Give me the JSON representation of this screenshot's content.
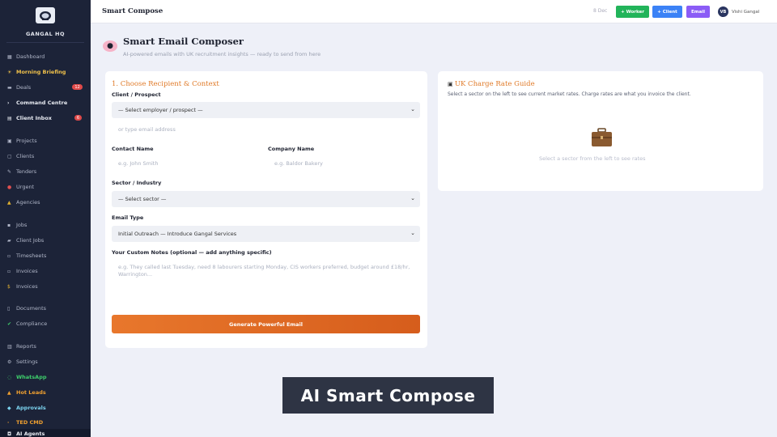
{
  "sidebar": {
    "brand": "GANGAL HQ",
    "logo_icon": "shield-logo-icon",
    "items": [
      {
        "label": "Dashboard",
        "icon": "grid-icon"
      },
      {
        "label": "Morning Briefing",
        "icon": "sun-icon"
      },
      {
        "label": "Deals",
        "icon": "deal-icon",
        "badge": "12"
      },
      {
        "label": "Command Centre",
        "icon": "command-icon"
      },
      {
        "label": "Client Inbox",
        "icon": "inbox-icon",
        "badge": "6"
      },
      {
        "label": "Projects",
        "icon": "folder-icon"
      },
      {
        "label": "Clients",
        "icon": "clients-icon"
      },
      {
        "label": "Tenders",
        "icon": "tender-icon"
      },
      {
        "label": "Urgent",
        "icon": "alert-icon"
      },
      {
        "label": "Agencies",
        "icon": "agency-icon"
      },
      {
        "label": "Jobs",
        "icon": "briefcase-icon"
      },
      {
        "label": "Client Jobs",
        "icon": "client-jobs-icon"
      },
      {
        "label": "Timesheets",
        "icon": "timesheet-icon"
      },
      {
        "label": "Invoices",
        "icon": "invoice-icon"
      },
      {
        "label": "Documents",
        "icon": "document-icon"
      },
      {
        "label": "Compliance",
        "icon": "check-icon"
      },
      {
        "label": "Reports",
        "icon": "report-icon"
      },
      {
        "label": "Settings",
        "icon": "gear-icon"
      },
      {
        "label": "WhatsApp",
        "icon": "whatsapp-icon"
      },
      {
        "label": "Hot Leads",
        "icon": "fire-icon"
      },
      {
        "label": "Approvals",
        "icon": "approval-icon"
      },
      {
        "label": "TED CMD",
        "icon": "ted-icon"
      },
      {
        "label": "AI Agents",
        "icon": "robot-icon"
      }
    ]
  },
  "topbar": {
    "title": "Smart Compose",
    "date": "8 Dec",
    "buttons": [
      {
        "label": "+ Worker",
        "color": "#22b45a"
      },
      {
        "label": "+ Client",
        "color": "#3b82f6"
      },
      {
        "label": "Email",
        "color": "#8b5cf6"
      }
    ],
    "user": {
      "initials": "VB",
      "name": "Vishi Gangal"
    }
  },
  "page": {
    "icon": "brain-icon",
    "title": "Smart Email Composer",
    "subtitle": "AI-powered emails with UK recruitment insights — ready to send from here"
  },
  "form": {
    "section_title": "1. Choose Recipient & Context",
    "client_label": "Client / Prospect",
    "client_value": "— Select employer / prospect —",
    "email_placeholder": "or type email address",
    "contact_label": "Contact Name",
    "contact_placeholder": "e.g. John Smith",
    "company_label": "Company Name",
    "company_placeholder": "e.g. Baldor Bakery",
    "sector_label": "Sector / Industry",
    "sector_value": "— Select sector —",
    "email_type_label": "Email Type",
    "email_type_value": "Initial Outreach — Introduce Gangal Services",
    "notes_label": "Your Custom Notes (optional — add anything specific)",
    "notes_placeholder": "e.g. They called last Tuesday, need 8 labourers starting Monday, CIS workers preferred, budget around £18/hr, Warrington...",
    "generate_label": "Generate Powerful Email"
  },
  "rate_guide": {
    "title": "UK Charge Rate Guide",
    "description": "Select a sector on the left to see current market rates. Charge rates are what you invoice the client.",
    "empty_icon": "briefcase-icon",
    "empty_text": "Select a sector from the left to see rates"
  },
  "caption": "AI Smart Compose",
  "colors": {
    "sidebar_bg": "#1c2338",
    "accent_orange": "#e07a28",
    "generate_gradient": [
      "#e8772c",
      "#d65d1c"
    ]
  }
}
